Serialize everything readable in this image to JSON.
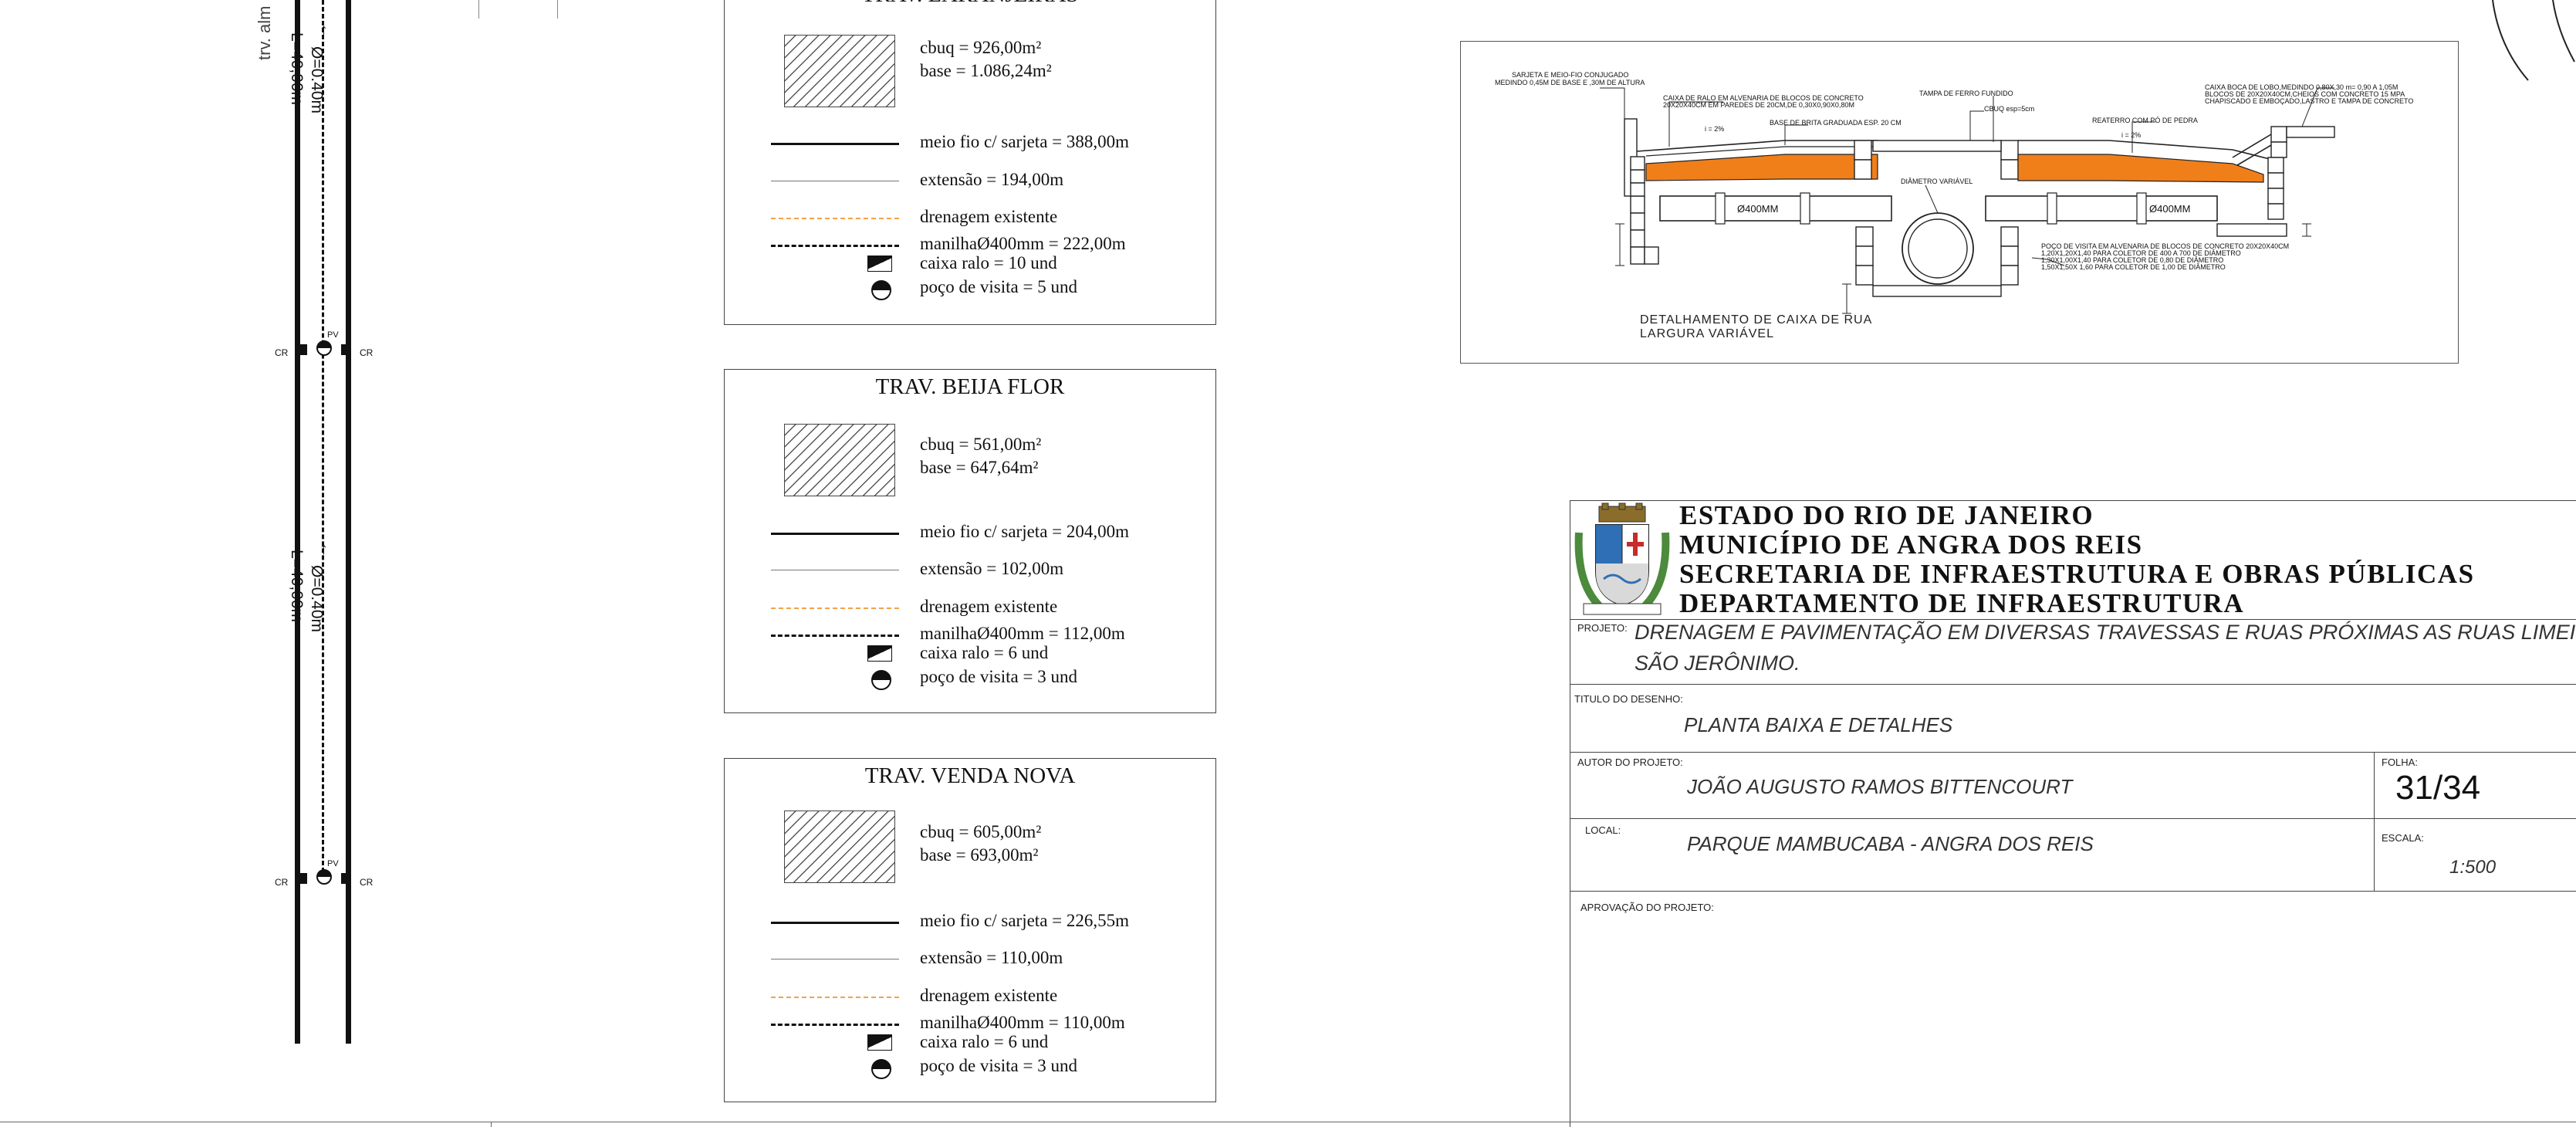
{
  "road": {
    "street_label": "trv. alm",
    "dim_top": "Ø=0.40m",
    "len_top": "L=40,00m",
    "dim_mid": "Ø=0.40m",
    "len_mid": "L=40,00m",
    "cr_label": "CR",
    "pv_label": "PV"
  },
  "legends": [
    {
      "title": "TRAV. LARANJEIRAS",
      "cbuq": "cbuq = 926,00m²",
      "base": "base = 1.086,24m²",
      "meio_fio": "meio fio c/ sarjeta = 388,00m",
      "extensao": "extensão = 194,00m",
      "drenagem": "drenagem existente",
      "manilha": "manilhaØ400mm = 222,00m",
      "caixa": "caixa ralo = 10 und",
      "poco": "poço de visita = 5 und"
    },
    {
      "title": "TRAV. BEIJA FLOR",
      "cbuq": "cbuq = 561,00m²",
      "base": "base = 647,64m²",
      "meio_fio": "meio fio c/ sarjeta = 204,00m",
      "extensao": "extensão = 102,00m",
      "drenagem": "drenagem existente",
      "manilha": "manilhaØ400mm = 112,00m",
      "caixa": "caixa ralo = 6 und",
      "poco": "poço de visita = 3 und"
    },
    {
      "title": "TRAV. VENDA NOVA",
      "cbuq": "cbuq = 605,00m²",
      "base": "base = 693,00m²",
      "meio_fio": "meio fio c/ sarjeta = 226,55m",
      "extensao": "extensão = 110,00m",
      "drenagem": "drenagem existente",
      "manilha": "manilhaØ400mm = 110,00m",
      "caixa": "caixa ralo = 6 und",
      "poco": "poço de visita = 3 und"
    }
  ],
  "detail": {
    "caption_line1": "DETALHAMENTO DE CAIXA DE RUA",
    "caption_line2": "LARGURA VARIÁVEL",
    "note_sarjeta": "SARJETA E MEIO-FIO CONJUGADO",
    "note_sarjeta2": "MEDINDO 0,45M DE BASE E ,30M DE ALTURA",
    "note_caixa_ralo": "CAIXA DE RALO EM ALVENARIA DE BLOCOS DE CONCRETO",
    "note_caixa_ralo2": "20X20X40CM EM PAREDES DE 20CM,DE 0,30X0,90X0,80M",
    "note_tampa": "TAMPA DE FERRO FUNDIDO",
    "note_cbuq": "CBUQ esp=5cm",
    "note_base": "BASE DE BRITA GRADUADA ESP. 20 CM",
    "note_slope_left": "i = 2%",
    "note_slope_right": "i = 2%",
    "note_reaterro": "REATERRO COM PÓ DE PEDRA",
    "note_diametro": "DIÂMETRO VARIÁVEL",
    "note_pipe_left": "Ø400MM",
    "note_pipe_right": "Ø400MM",
    "note_boca_lobo": "CAIXA BOCA DE LOBO,MEDINDO 0,80X,30 m= 0,90 A 1,05M",
    "note_boca_lobo2": "BLOCOS DE 20X20X40CM,CHEIOS COM CONCRETO 15 MPA",
    "note_boca_lobo3": "CHAPISCADO E EMBOÇADO,LASTRO E TAMPA DE CONCRETO",
    "note_poco1": "POÇO DE VISITA EM ALVENARIA DE BLOCOS DE CONCRETO 20X20X40CM",
    "note_poco2": "1,20X1,20X1,40  PARA COLETOR DE 400 A 700 DE DIÂMETRO",
    "note_poco3": "1,30X1,00X1,40  PARA COLETOR DE 0,80 DE DIÂMETRO",
    "note_poco4": "1,50X1,50X 1,60  PARA COLETOR DE 1,00 DE DIÂMETRO"
  },
  "titleblock": {
    "line1": "ESTADO DO RIO DE JANEIRO",
    "line2": "MUNICÍPIO DE ANGRA DOS REIS",
    "line3": "SECRETARIA DE INFRAESTRUTURA E OBRAS PÚBLICAS",
    "line4": "DEPARTAMENTO DE INFRAESTRUTURA",
    "projeto_label": "PROJETO:",
    "projeto_value1": "DRENAGEM E PAVIMENTAÇÃO EM DIVERSAS TRAVESSAS E RUAS PRÓXIMAS AS RUAS LIMEIRA E",
    "projeto_value2": "SÃO JERÔNIMO.",
    "titulo_label": "TITULO DO DESENHO:",
    "titulo_value": "PLANTA BAIXA E DETALHES",
    "autor_label": "AUTOR DO PROJETO:",
    "autor_value": "JOÃO AUGUSTO RAMOS BITTENCOURT",
    "folha_label": "FOLHA:",
    "folha_value": "31/34",
    "local_label": "LOCAL:",
    "local_value": "PARQUE MAMBUCABA - ANGRA DOS REIS",
    "escala_label": "ESCALA:",
    "escala_value": "1:500",
    "aprovacao_label": "APROVAÇÃO DO PROJETO:"
  },
  "colors": {
    "drenagem": "#f2a24a",
    "base_fill": "#f07f1a"
  }
}
